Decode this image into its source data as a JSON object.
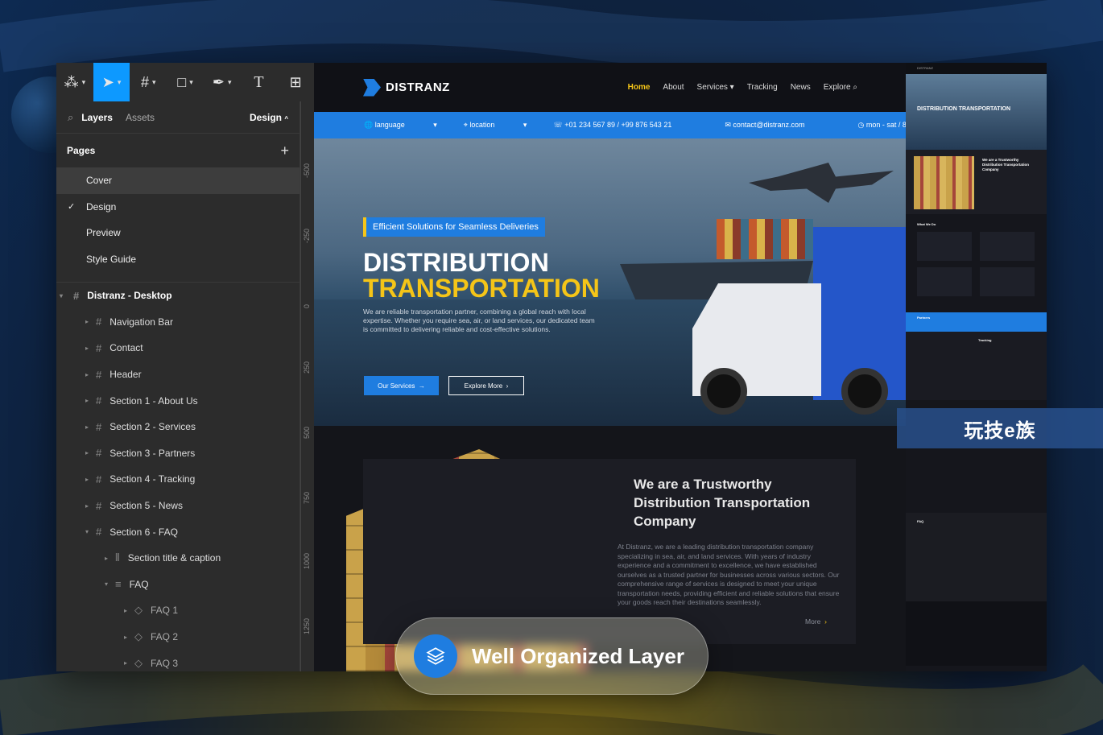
{
  "toolbar": {
    "tools": [
      "figma-menu",
      "move-tool",
      "frame-tool",
      "shape-tool",
      "pen-tool",
      "text-tool",
      "resources-tool"
    ]
  },
  "panel": {
    "tab_layers": "Layers",
    "tab_assets": "Assets",
    "tab_design": "Design",
    "pages_title": "Pages",
    "pages": [
      "Cover",
      "Design",
      "Preview",
      "Style Guide"
    ],
    "selected_page": "Design",
    "layers": [
      {
        "name": "Distranz - Desktop",
        "level": 0,
        "open": true
      },
      {
        "name": "Navigation Bar",
        "level": 1
      },
      {
        "name": "Contact",
        "level": 1
      },
      {
        "name": "Header",
        "level": 1
      },
      {
        "name": "Section 1 - About Us",
        "level": 1
      },
      {
        "name": "Section 2 - Services",
        "level": 1
      },
      {
        "name": "Section 3 - Partners",
        "level": 1
      },
      {
        "name": "Section 4 - Tracking",
        "level": 1
      },
      {
        "name": "Section 5 - News",
        "level": 1
      },
      {
        "name": "Section 6 - FAQ",
        "level": 1,
        "open": true
      },
      {
        "name": "Section title & caption",
        "level": 2
      },
      {
        "name": "FAQ",
        "level": 2,
        "open": true
      },
      {
        "name": "FAQ 1",
        "level": 3
      },
      {
        "name": "FAQ 2",
        "level": 3
      },
      {
        "name": "FAQ 3",
        "level": 3
      }
    ]
  },
  "ruler": [
    "-500",
    "-250",
    "0",
    "250",
    "500",
    "750",
    "1000",
    "1250",
    "1500"
  ],
  "site": {
    "logo": "DISTRANZ",
    "menu": [
      "Home",
      "About",
      "Services",
      "Tracking",
      "News",
      "Explore"
    ],
    "active_menu": "Home",
    "contact": {
      "language": "language",
      "location": "location",
      "phone": "+01 234 567 89 / +99 876 543 21",
      "email": "contact@distranz.com",
      "hours": "mon - sat / 8 am - 6 pm"
    },
    "hero": {
      "badge": "Efficient Solutions for Seamless Deliveries",
      "title_line1": "DISTRIBUTION",
      "title_line2": "TRANSPORTATION",
      "desc": "We are reliable transportation partner, combining a global reach with local expertise. Whether you require sea, air, or land services, our dedicated team is committed to delivering reliable and cost-effective solutions.",
      "btn_primary": "Our Services",
      "btn_secondary": "Explore More"
    },
    "about": {
      "heading": "We are a Trustworthy Distribution Transportation Company",
      "text": "At Distranz, we are a leading distribution transportation company specializing in sea, air, and land services. With years of industry experience and a commitment to excellence, we have established ourselves as a trusted partner for businesses across various sectors. Our comprehensive range of services is designed to meet your unique transportation needs, providing efficient and reliable solutions that ensure your goods reach their destinations seamlessly.",
      "more": "More"
    }
  },
  "preview": {
    "hero_title": "DISTRIBUTION TRANSPORTATION",
    "about_title": "We are a Trustworthy Distribution Transportation Company",
    "what_we_do": "What We Do",
    "partners": "Partners",
    "tracking": "Tracking",
    "faq": "FAQ"
  },
  "watermark": "玩技e族",
  "pill": {
    "label": "Well Organized Layer"
  },
  "colors": {
    "accent_blue": "#1f7de0",
    "accent_yellow": "#f5c518",
    "figma_blue": "#0d99ff"
  }
}
